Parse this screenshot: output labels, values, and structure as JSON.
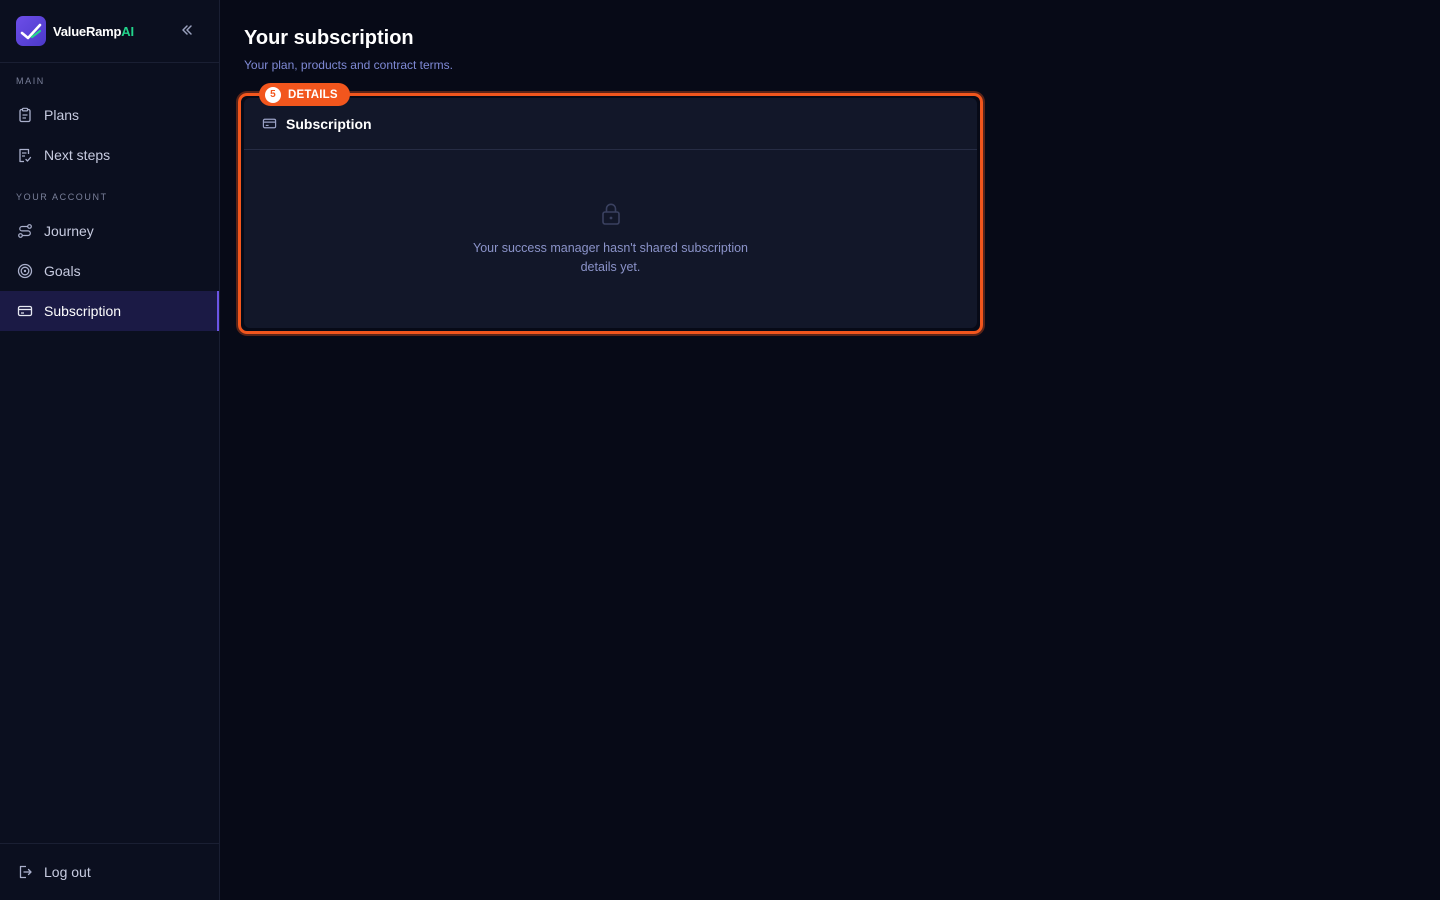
{
  "brand": {
    "name": "ValueRamp",
    "name_suffix": "AI"
  },
  "sidebar": {
    "sections": [
      {
        "label": "MAIN",
        "items": [
          {
            "label": "Plans",
            "icon": "clipboard-icon",
            "active": false
          },
          {
            "label": "Next steps",
            "icon": "checklist-icon",
            "active": false
          }
        ]
      },
      {
        "label": "YOUR ACCOUNT",
        "items": [
          {
            "label": "Journey",
            "icon": "route-icon",
            "active": false
          },
          {
            "label": "Goals",
            "icon": "target-icon",
            "active": false
          },
          {
            "label": "Subscription",
            "icon": "credit-card-icon",
            "active": true
          }
        ]
      }
    ],
    "footer": {
      "label": "Log out",
      "icon": "logout-icon"
    }
  },
  "page": {
    "title": "Your subscription",
    "subtitle": "Your plan, products and contract terms."
  },
  "card": {
    "title": "Subscription",
    "icon": "credit-card-icon",
    "empty_icon": "lock-icon",
    "empty_message": "Your success manager hasn't shared subscription details yet."
  },
  "annotation": {
    "number": "5",
    "label": "DETAILS"
  },
  "colors": {
    "background": "#070a17",
    "sidebar": "#0b0f1f",
    "accent": "#6c55e6",
    "brand_ai": "#22d38a",
    "highlight": "#f2561d",
    "card": "#121729"
  }
}
